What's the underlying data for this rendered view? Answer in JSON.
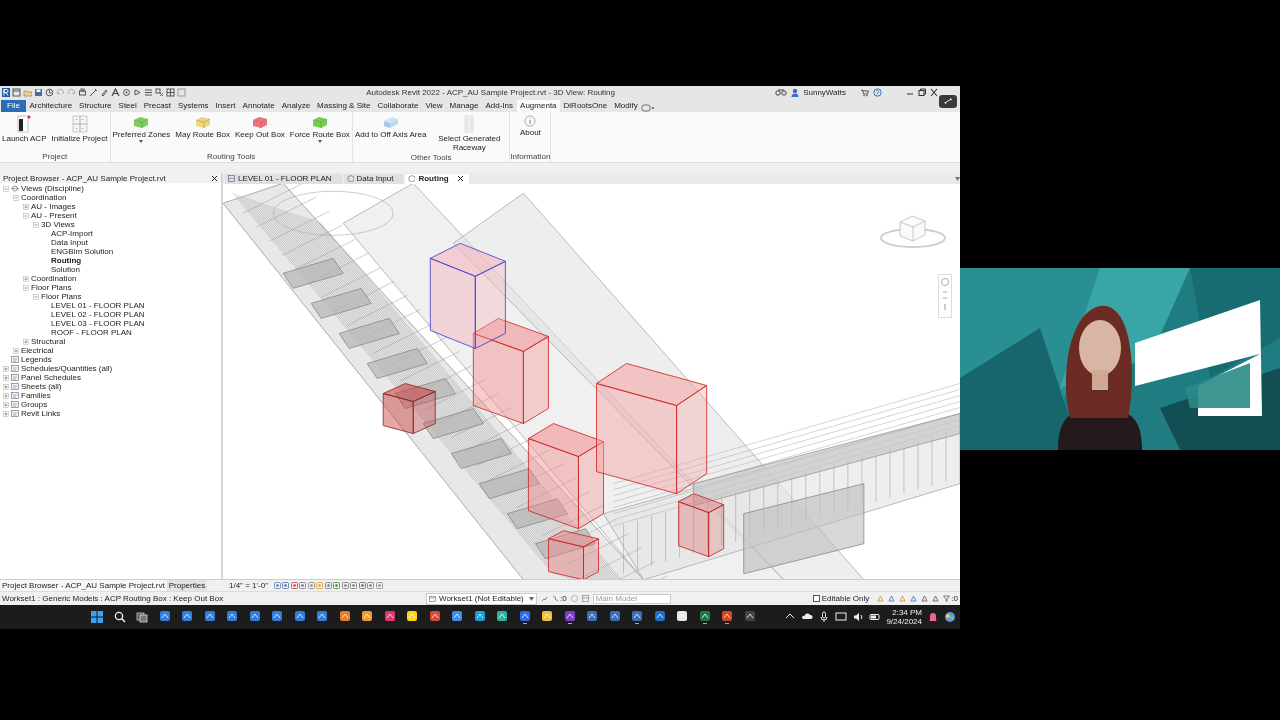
{
  "window": {
    "title": "Autodesk Revit 2022 - ACP_AU Sample Project.rvt - 3D View: Routing",
    "user": "SunnyWatts"
  },
  "ribbon_tabs": [
    {
      "label": "File",
      "kind": "file",
      "selected": false
    },
    {
      "label": "Architecture",
      "kind": "tab",
      "selected": false
    },
    {
      "label": "Structure",
      "kind": "tab",
      "selected": false
    },
    {
      "label": "Steel",
      "kind": "tab",
      "selected": false
    },
    {
      "label": "Precast",
      "kind": "tab",
      "selected": false
    },
    {
      "label": "Systems",
      "kind": "tab",
      "selected": false
    },
    {
      "label": "Insert",
      "kind": "tab",
      "selected": false
    },
    {
      "label": "Annotate",
      "kind": "tab",
      "selected": false
    },
    {
      "label": "Analyze",
      "kind": "tab",
      "selected": false
    },
    {
      "label": "Massing & Site",
      "kind": "tab",
      "selected": false
    },
    {
      "label": "Collaborate",
      "kind": "tab",
      "selected": false
    },
    {
      "label": "View",
      "kind": "tab",
      "selected": false
    },
    {
      "label": "Manage",
      "kind": "tab",
      "selected": false
    },
    {
      "label": "Add-Ins",
      "kind": "tab",
      "selected": false
    },
    {
      "label": "Augmenta",
      "kind": "tab",
      "selected": true
    },
    {
      "label": "DiRootsOne",
      "kind": "tab",
      "selected": false
    },
    {
      "label": "Modify",
      "kind": "tab",
      "selected": false
    }
  ],
  "ribbon_panels": [
    {
      "label": "Project",
      "buttons": [
        {
          "label": "Launch ACP",
          "kind": "launch",
          "dropdown": false
        },
        {
          "label": "Initialize Project",
          "kind": "grid",
          "dropdown": false
        }
      ]
    },
    {
      "label": "Routing Tools",
      "buttons": [
        {
          "label": "Preferred Zones",
          "kind": "box",
          "color": "#7ccf5a",
          "dropdown": true
        },
        {
          "label": "May Route Box",
          "kind": "box",
          "color": "#f1d77a",
          "dropdown": false
        },
        {
          "label": "Keep Out Box",
          "kind": "box",
          "color": "#ef6f7a",
          "dropdown": false
        },
        {
          "label": "Force Route Box",
          "kind": "box",
          "color": "#73d04e",
          "dropdown": true
        }
      ]
    },
    {
      "label": "Other Tools",
      "buttons": [
        {
          "label": "Add to Off Axis Area",
          "kind": "axis",
          "dropdown": false
        },
        {
          "label": "Select Generated Raceway",
          "kind": "raceway",
          "dropdown": false
        }
      ]
    },
    {
      "label": "Information",
      "buttons": [
        {
          "label": "About",
          "kind": "info",
          "dropdown": false
        }
      ]
    }
  ],
  "project_browser": {
    "title": "Project Browser - ACP_AU Sample Project.rvt",
    "tree": [
      {
        "label": "Views (Discipline)",
        "expanded": true,
        "selected": false,
        "children": [
          {
            "label": "Coordination",
            "expanded": true,
            "selected": false,
            "children": [
              {
                "label": "AU - Images",
                "expanded": false,
                "selected": false
              },
              {
                "label": "AU - Present",
                "expanded": true,
                "selected": false,
                "children": [
                  {
                    "label": "3D Views",
                    "expanded": true,
                    "selected": false,
                    "children": [
                      {
                        "label": "ACP-Import",
                        "selected": false
                      },
                      {
                        "label": "Data Input",
                        "selected": false
                      },
                      {
                        "label": "ENGBim Solution",
                        "selected": false
                      },
                      {
                        "label": "Routing",
                        "selected": true
                      },
                      {
                        "label": "Solution",
                        "selected": false
                      }
                    ]
                  }
                ]
              },
              {
                "label": "Coordination",
                "expanded": false,
                "selected": false
              },
              {
                "label": "Floor Plans",
                "expanded": true,
                "selected": false,
                "children": [
                  {
                    "label": "Floor Plans",
                    "expanded": true,
                    "selected": false,
                    "children": [
                      {
                        "label": "LEVEL 01 - FLOOR PLAN",
                        "selected": false
                      },
                      {
                        "label": "LEVEL 02 - FLOOR PLAN",
                        "selected": false
                      },
                      {
                        "label": "LEVEL 03 - FLOOR PLAN",
                        "selected": false
                      },
                      {
                        "label": "ROOF - FLOOR PLAN",
                        "selected": false
                      }
                    ]
                  }
                ]
              },
              {
                "label": "Structural",
                "expanded": false,
                "selected": false
              }
            ]
          },
          {
            "label": "Electrical",
            "expanded": false,
            "selected": false
          }
        ]
      },
      {
        "label": "Legends",
        "selected": false
      },
      {
        "label": "Schedules/Quantities (all)",
        "expanded": false,
        "selected": false
      },
      {
        "label": "Panel Schedules",
        "expanded": false,
        "selected": false
      },
      {
        "label": "Sheets (all)",
        "expanded": false,
        "selected": false
      },
      {
        "label": "Families",
        "expanded": false,
        "selected": false
      },
      {
        "label": "Groups",
        "expanded": false,
        "selected": false
      },
      {
        "label": "Revit Links",
        "expanded": false,
        "selected": false
      }
    ]
  },
  "view_tabs": [
    {
      "label": "LEVEL 01 - FLOOR PLAN",
      "selected": false
    },
    {
      "label": "Data Input",
      "selected": false
    },
    {
      "label": "Routing",
      "selected": true
    }
  ],
  "browser_tabs": [
    {
      "label": "Project Browser - ACP_AU Sample Project.rvt",
      "selected": true
    },
    {
      "label": "Properties",
      "selected": false
    }
  ],
  "view_scale": "1/4\" = 1'-0\"",
  "status_bar": {
    "selection": "Workset1 : Generic Models : ACP Routing Box : Keep Out Box",
    "workset": "Workset1 (Not Editable)",
    "count": ":0",
    "model_placeholder": "Main Model",
    "editable_only": {
      "label": "Editable Only",
      "checked": false
    },
    "filter_count": ":0"
  },
  "taskbar": {
    "apps": [
      {
        "color": "#2f7de1",
        "running": false
      },
      {
        "color": "#2f7de1",
        "running": false
      },
      {
        "color": "#2f7de1",
        "running": false
      },
      {
        "color": "#2f7de1",
        "running": false
      },
      {
        "color": "#2f7de1",
        "running": false
      },
      {
        "color": "#2f7de1",
        "running": false
      },
      {
        "color": "#2f7de1",
        "running": false
      },
      {
        "color": "#2f7de1",
        "running": false
      },
      {
        "color": "#e87c2a",
        "running": false
      },
      {
        "color": "#f09a36",
        "running": false
      },
      {
        "color": "#e0376a",
        "running": false
      },
      {
        "color": "#ffd21e",
        "running": false
      },
      {
        "color": "#d64937",
        "running": false
      },
      {
        "color": "#3e8ee8",
        "running": false
      },
      {
        "color": "#1aa0d8",
        "running": false
      },
      {
        "color": "#2bb3a0",
        "running": false
      },
      {
        "color": "#2d6cf0",
        "running": true
      },
      {
        "color": "#f0c040",
        "running": false
      },
      {
        "color": "#7a3fc8",
        "running": true
      },
      {
        "color": "#3c6fb8",
        "running": false
      },
      {
        "color": "#3c6fb8",
        "running": false
      },
      {
        "color": "#3c6fb8",
        "running": true
      },
      {
        "color": "#1f6fd1",
        "running": false
      },
      {
        "color": "#e8e8e8",
        "running": false
      },
      {
        "color": "#1e7a45",
        "running": true
      },
      {
        "color": "#d24726",
        "running": true
      },
      {
        "color": "#444444",
        "running": false
      }
    ],
    "time": "2:34 PM",
    "date": "9/24/2024"
  }
}
